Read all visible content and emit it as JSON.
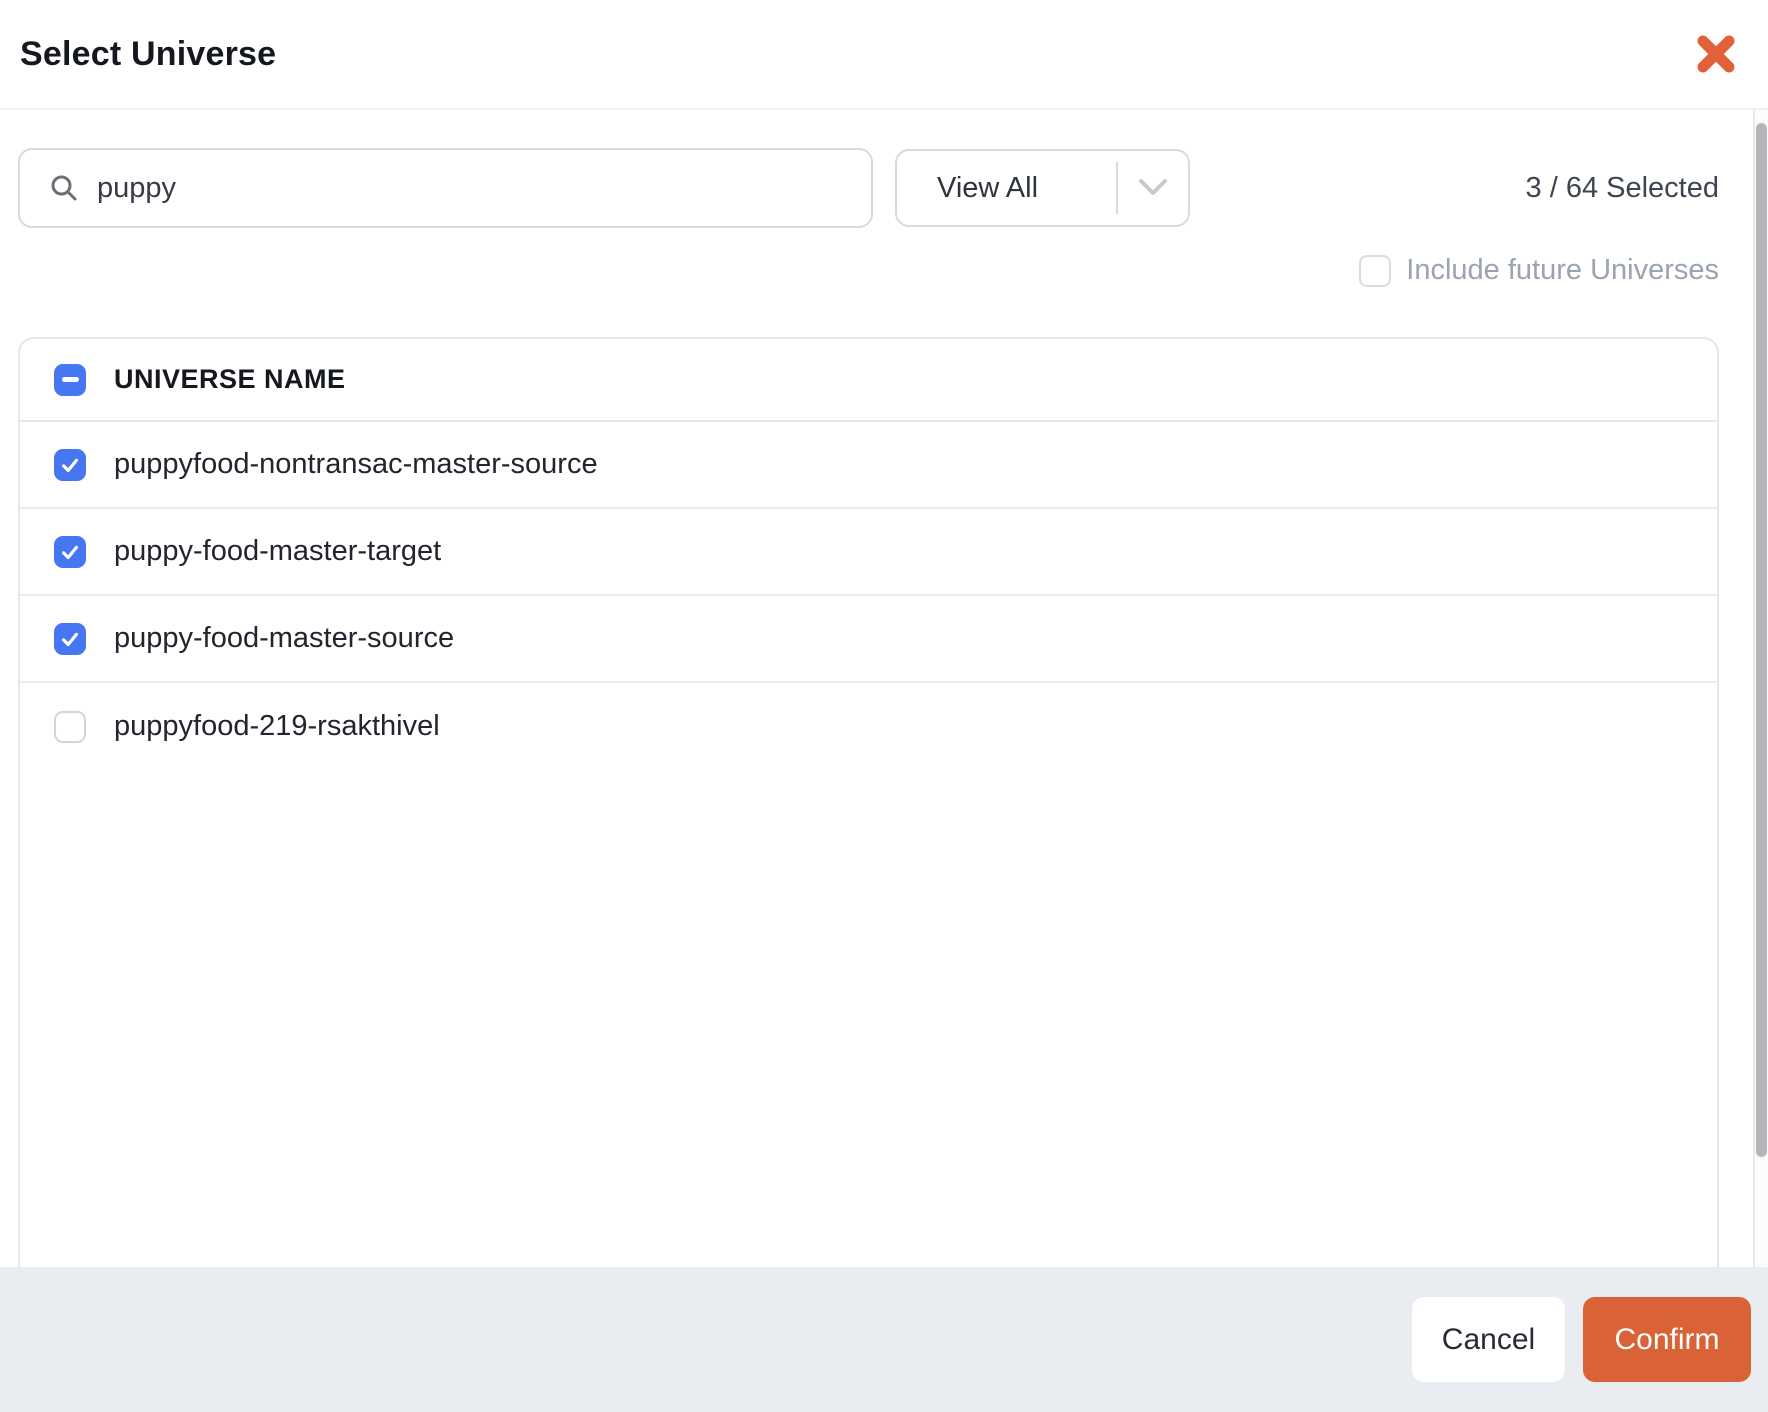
{
  "modal": {
    "title": "Select Universe"
  },
  "icons": {
    "close": "x-mark",
    "search": "magnifier",
    "dropdown_caret": "chevron-down",
    "checked": "check-mark",
    "indeterminate": "minus"
  },
  "toolbar": {
    "search_value": "puppy",
    "search_placeholder": "",
    "filter_selected_option": "View All",
    "selected_count": "3 / 64 Selected",
    "include_future_label": "Include future Universes",
    "include_future_checked": false
  },
  "table": {
    "header_label": "UNIVERSE NAME",
    "header_checkbox_state": "indeterminate",
    "rows": [
      {
        "name": "puppyfood-nontransac-master-source",
        "checked": true
      },
      {
        "name": "puppy-food-master-target",
        "checked": true
      },
      {
        "name": "puppy-food-master-source",
        "checked": true
      },
      {
        "name": "puppyfood-219-rsakthivel",
        "checked": false
      }
    ]
  },
  "footer": {
    "cancel_label": "Cancel",
    "confirm_label": "Confirm"
  },
  "colors": {
    "accent_blue": "#4676F1",
    "accent_orange": "#D96236",
    "footer_bg": "#E9ECF1",
    "muted_text": "#9BA3B1"
  }
}
